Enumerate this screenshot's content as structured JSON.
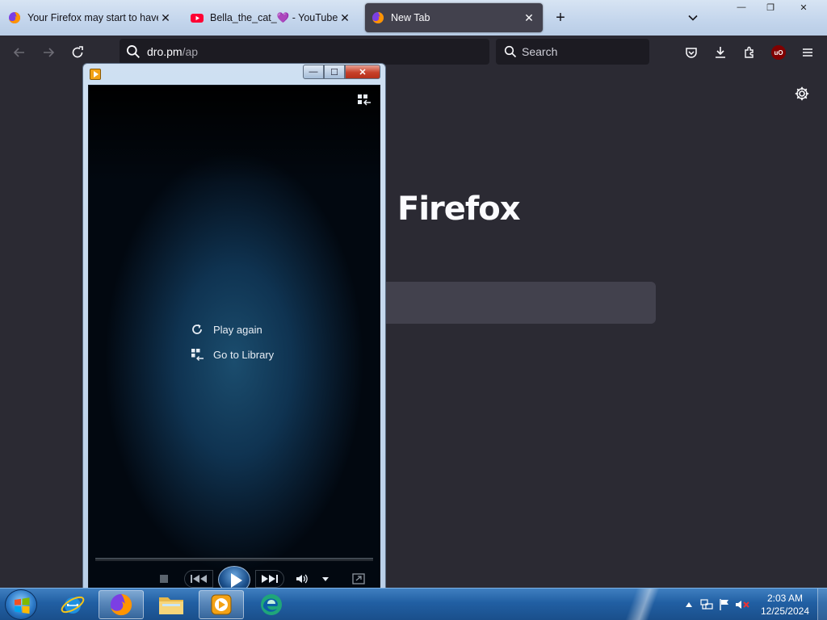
{
  "browser": {
    "tabs": [
      {
        "title": "Your Firefox may start to have p",
        "favicon": "firefox-icon",
        "active": false
      },
      {
        "title": "Bella_the_cat_💜 - YouTube",
        "favicon": "youtube-icon",
        "active": false
      },
      {
        "title": "New Tab",
        "favicon": "firefox-icon",
        "active": true
      }
    ],
    "new_tab_symbol": "+",
    "close_symbol": "✕",
    "window_controls": {
      "minimize": "—",
      "restore": "❐",
      "close": "✕"
    },
    "url": {
      "host": "dro.pm",
      "path": "/ap"
    },
    "search_placeholder": "Search",
    "toolbar_icons": [
      "pocket-icon",
      "downloads-icon",
      "extensions-icon",
      "ublock-icon",
      "menu-icon"
    ],
    "ublock_label": "uO"
  },
  "newtab": {
    "brand": "Firefox",
    "settings_icon": "gear-icon"
  },
  "media_player": {
    "window_controls": {
      "minimize": "—",
      "maximize": "☐",
      "close": "✕"
    },
    "menu": [
      {
        "label": "Play again",
        "icon": "replay-icon"
      },
      {
        "label": "Go to Library",
        "icon": "library-icon"
      }
    ],
    "controls": [
      "stop-icon",
      "previous-icon",
      "play-icon",
      "next-icon",
      "volume-icon",
      "volume-dropdown-icon",
      "fullscreen-icon"
    ]
  },
  "taskbar": {
    "pinned": [
      "internet-explorer-icon",
      "firefox-icon",
      "file-explorer-icon",
      "windows-media-player-icon",
      "edge-icon"
    ],
    "active_app": "firefox-icon",
    "tray_icons": [
      "show-hidden-icons-icon",
      "network-icon",
      "action-center-flag-icon",
      "volume-muted-icon"
    ],
    "clock": {
      "time": "2:03 AM",
      "date": "12/25/2024"
    }
  },
  "colors": {
    "firefox_dark_bg": "#2b2a33",
    "active_tab": "#42414d",
    "urlbar_bg": "#1c1b22",
    "taskbar_blue": "#215fa3",
    "wmp_close_red": "#c7412a"
  }
}
